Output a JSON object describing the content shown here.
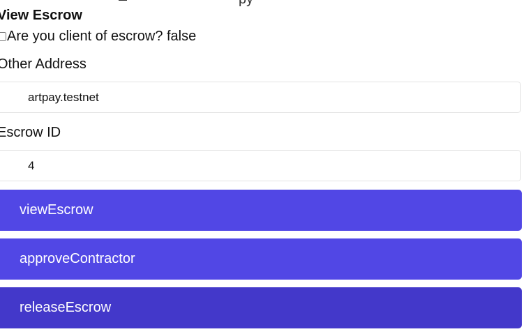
{
  "header": {
    "clipped_text": "                                         py",
    "title": "View Escrow"
  },
  "client_check": {
    "label": "Are you client of escrow? false",
    "checked": false
  },
  "other_address": {
    "label": "Other Address",
    "value": "artpay.testnet"
  },
  "escrow_id": {
    "label": "Escrow ID",
    "value": "4"
  },
  "buttons": {
    "view_escrow": "viewEscrow",
    "approve_contractor": "approveContractor",
    "release_escrow": "releaseEscrow"
  },
  "colors": {
    "button_primary": "#5147e5",
    "button_active": "#4338ca",
    "input_border": "#e3e3e3"
  }
}
